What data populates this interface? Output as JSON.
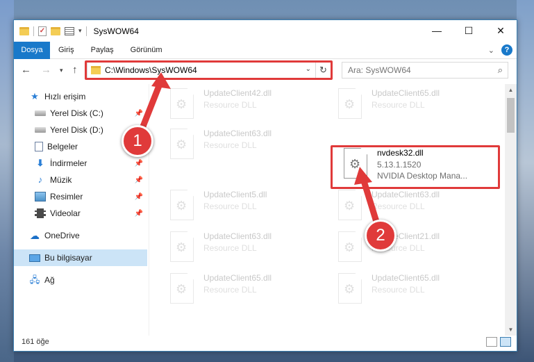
{
  "window": {
    "title": "SysWOW64",
    "controls": {
      "minimize": "—",
      "maximize": "☐",
      "close": "✕"
    }
  },
  "ribbon": {
    "tabs": [
      "Dosya",
      "Giriş",
      "Paylaş",
      "Görünüm"
    ]
  },
  "navbar": {
    "address": "C:\\Windows\\SysWOW64",
    "search_placeholder": "Ara: SysWOW64"
  },
  "sidebar": {
    "items": [
      {
        "label": "Hızlı erişim",
        "icon": "star-icon"
      },
      {
        "label": "Yerel Disk (C:)",
        "icon": "disk-icon",
        "pinned": true
      },
      {
        "label": "Yerel Disk (D:)",
        "icon": "disk-icon",
        "pinned": true
      },
      {
        "label": "Belgeler",
        "icon": "document-icon",
        "pinned": true
      },
      {
        "label": "İndirmeler",
        "icon": "download-icon",
        "pinned": true
      },
      {
        "label": "Müzik",
        "icon": "music-icon",
        "pinned": true
      },
      {
        "label": "Resimler",
        "icon": "pictures-icon",
        "pinned": true
      },
      {
        "label": "Videolar",
        "icon": "video-icon",
        "pinned": true
      },
      {
        "label": "OneDrive",
        "icon": "onedrive-icon"
      },
      {
        "label": "Bu bilgisayar",
        "icon": "computer-icon",
        "selected": true
      },
      {
        "label": "Ağ",
        "icon": "network-icon"
      }
    ]
  },
  "files": [
    {
      "name": "UpdateClient42.dll",
      "type": "Resource DLL"
    },
    {
      "name": "UpdateClient65.dll",
      "type": "Resource DLL"
    },
    {
      "name": "UpdateClient63.dll",
      "type": "Resource DLL"
    },
    {
      "name": "nvdesk32.dll",
      "version": "5.13.1.1520",
      "description": "NVIDIA Desktop Mana...",
      "highlighted": true
    },
    {
      "name": "UpdateClient5.dll",
      "type": "Resource DLL"
    },
    {
      "name": "UpdateClient63.dll",
      "type": "Resource DLL"
    },
    {
      "name": "UpdateClient63.dll",
      "type": "Resource DLL"
    },
    {
      "name": "UpdateClient21.dll",
      "type": "Resource DLL"
    },
    {
      "name": "UpdateClient65.dll",
      "type": "Resource DLL"
    },
    {
      "name": "UpdateClient65.dll",
      "type": "Resource DLL"
    }
  ],
  "status": {
    "count": "161 öğe"
  },
  "annotations": {
    "step1": "1",
    "step2": "2",
    "color": "#e03a3a"
  }
}
